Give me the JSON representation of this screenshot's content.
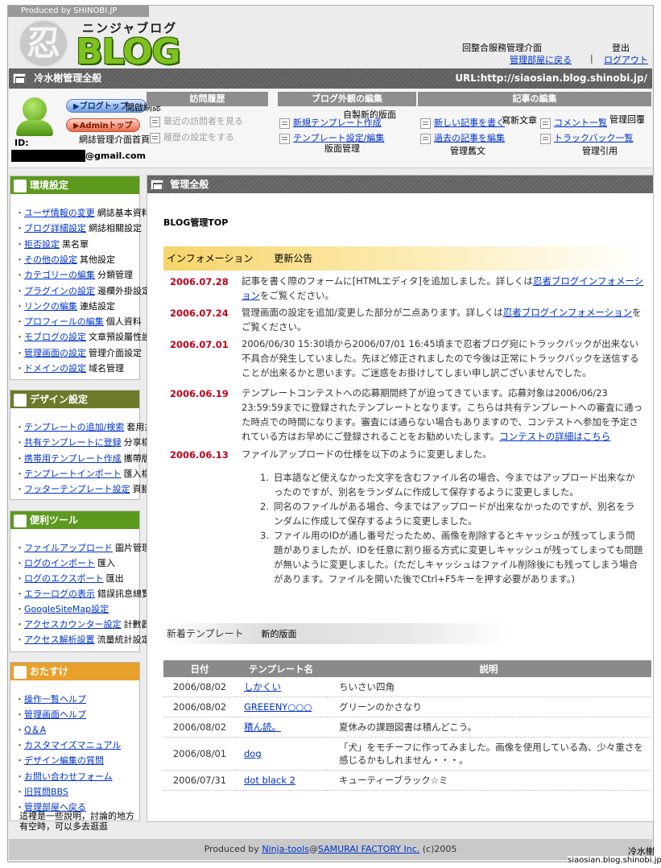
{
  "header": {
    "produced": "Produced by SHINOBI.JP",
    "logo_mark": "忍",
    "logo_sub": "ニンジャブログ",
    "logo_blog": "BLOG",
    "ann_panel": "回整合服務管理介面",
    "ann_logout": "登出",
    "admin_link": "管理部屋に戻る",
    "separator": "|",
    "logout_link": "ログアウト"
  },
  "titlebar": {
    "title": "冷水榭管理全般",
    "url": "URL:http://siaosian.blog.shinobi.jp/"
  },
  "user": {
    "blog_top_btn": "▶ブログトップ",
    "blog_top_ann": "開啟網誌",
    "admin_top_btn": "▶Adminトップ",
    "admin_top_ann": "網誌管理介面首頁",
    "id_label": "ID:",
    "email_suffix": "@gmail.com"
  },
  "columns": {
    "visit": {
      "head": "訪問履歴",
      "items": [
        "最近の訪問者を見る",
        "履歴の設定をする"
      ]
    },
    "design": {
      "head": "ブログ外観の編集",
      "items": [
        "新規テンプレート作成",
        "テンプレート設定/編集"
      ],
      "ann": [
        "自製新的版面",
        "版面管理"
      ]
    },
    "article": {
      "head": "記事の編集",
      "items": [
        "新しい記事を書く",
        "過去の記事を編集",
        "コメント一覧",
        "トラックバック一覧"
      ],
      "ann": [
        "寫新文章",
        "管理舊文",
        "管理回覆",
        "管理引用"
      ]
    }
  },
  "sidebar": {
    "env": {
      "title": "環境設定",
      "items": [
        {
          "label": "ユーザ情報の変更",
          "ann": "網誌基本資料"
        },
        {
          "label": "ブログ詳細設定",
          "ann": "網誌相關設定"
        },
        {
          "label": "拒否設定",
          "ann": "黑名單"
        },
        {
          "label": "その他の設定",
          "ann": "其他設定"
        },
        {
          "label": "カテゴリーの編集",
          "ann": "分類管理"
        },
        {
          "label": "プラグインの設定",
          "ann": "邊欄外掛設定"
        },
        {
          "label": "リンクの編集",
          "ann": "連結設定"
        },
        {
          "label": "プロフィールの編集",
          "ann": "個人資料"
        },
        {
          "label": "モブログの設定",
          "ann": "文章預設屬性設定"
        },
        {
          "label": "管理画面の設定",
          "ann": "管理介面設定"
        },
        {
          "label": "ドメインの設定",
          "ann": "域名管理"
        }
      ]
    },
    "design": {
      "title": "デザイン設定",
      "items": [
        {
          "label": "テンプレートの追加/検索",
          "ann": "套用共享樣式"
        },
        {
          "label": "共有テンプレートに登録",
          "ann": "分享樣式"
        },
        {
          "label": "携帯用テンプレート作成",
          "ann": "攜帶版樣式"
        },
        {
          "label": "テンプレートインポート",
          "ann": "匯入樣式"
        },
        {
          "label": "フッターテンプレート設定",
          "ann": "頁腳/廣告設定"
        }
      ]
    },
    "tools": {
      "title": "便利ツール",
      "items": [
        {
          "label": "ファイルアップロード",
          "ann": "圖片管理"
        },
        {
          "label": "ログのインポート",
          "ann": "匯入"
        },
        {
          "label": "ログのエクスポート",
          "ann": "匯出"
        },
        {
          "label": "エラーログの表示",
          "ann": "錯誤訊息總覽"
        },
        {
          "label": "GoogleSiteMap設定",
          "ann": ""
        },
        {
          "label": "アクセスカウンター設定",
          "ann": "計數器設定"
        },
        {
          "label": "アクセス解析設置",
          "ann": "流量統計設定"
        }
      ]
    },
    "help": {
      "title": "おたすけ",
      "items": [
        {
          "label": "操作一覧ヘルプ"
        },
        {
          "label": "管理画面ヘルプ"
        },
        {
          "label": "Q＆A"
        },
        {
          "label": "カスタマイズマニュアル"
        },
        {
          "label": "デザイン編集の質問"
        },
        {
          "label": "お問い合わせフォーム"
        },
        {
          "label": "旧質問BBS"
        },
        {
          "label": "管理部屋へ戻る"
        }
      ],
      "note_line1": "這裡是一些說明，討論的地方",
      "note_line2": "有空時，可以多去逛逛"
    }
  },
  "main": {
    "title": "管理全般",
    "page_label": "BLOG管理TOP",
    "info_title": "インフォメーション",
    "info_ann": "更新公告",
    "news": [
      {
        "date": "2006.07.28",
        "text": "記事を書く際のフォームに[HTMLエディタ]を追加しました。詳しくは",
        "link": "忍者ブログインフォメーション",
        "after": "をご覧ください。"
      },
      {
        "date": "2006.07.24",
        "text": "管理画面の設定を追加/変更した部分が二点あります。詳しくは",
        "link": "忍者ブログインフォメーション",
        "after": "をご覧ください。"
      },
      {
        "date": "2006.07.01",
        "text": "2006/06/30 15:30頃から2006/07/01 16:45頃まで忍者ブログ宛にトラックバックが出来ない不具合が発生していました。先ほど修正されましたので今後は正常にトラックバックを送信することが出来るかと思います。ご迷惑をお掛けしてしまい申し訳ございませんでした。",
        "link": "",
        "after": ""
      },
      {
        "date": "2006.06.19",
        "text": "テンプレートコンテストへの応募期間終了が迫ってきています。応募対象は2006/06/23 23:59:59までに登録されたテンプレートとなります。こちらは共有テンプレートへの審査に通った時点での時間になります。審査には通らない場合もありますので、コンテストへ参加を予定されている方はお早めにご登録されることをお勧めいたします。",
        "link": "コンテストの詳細はこちら",
        "after": ""
      },
      {
        "date": "2006.06.13",
        "text": "ファイルアップロードの仕様を以下のように変更しました。",
        "link": "",
        "after": ""
      }
    ],
    "list": [
      "日本語など使えなかった文字を含むファイル名の場合、今まではアップロード出来なかったのですが、別名をランダムに作成して保存するように変更しました。",
      "同名のファイルがある場合、今まではアップロードが出来なかったのですが、別名をランダムに作成して保存するように変更しました。",
      "ファイル用のIDが通し番号だったため、画像を削除するとキャッシュが残ってしまう問題がありましたが、IDを任意に割り振る方式に変更しキャッシュが残ってしまっても問題が無いように変更しました。(ただしキャッシュはファイル削除後にも残ってしまう場合があります。ファイルを開いた後でCtrl+F5キーを押す必要があります。)"
    ],
    "newtpl_title": "新着テンプレート",
    "newtpl_ann": "新的版面",
    "table": {
      "headers": [
        "日付",
        "テンプレート名",
        "説明"
      ],
      "rows": [
        [
          "2006/08/02",
          "しかくい",
          "ちいさい四角"
        ],
        [
          "2006/08/02",
          "GREEENY○○○",
          "グリーンのかさなり"
        ],
        [
          "2006/08/02",
          "積ん読。",
          "夏休みの課題図書は積んどこう。"
        ],
        [
          "2006/08/01",
          "dog",
          "「犬」をモチーフに作ってみました。画像を使用している為、少々重さを感じるかもしれません・・・。"
        ],
        [
          "2006/07/31",
          "dot black 2",
          "キューティーブラック☆ミ"
        ]
      ]
    }
  },
  "footer": {
    "prefix": "Produced by ",
    "link1": "Ninja-tools",
    "at": "@",
    "link2": "SAMURAI FACTORY Inc.",
    "suffix": " (c)2005",
    "sig_name": "冷水榭",
    "sig_url": "siaosian.blog.shinobi.jp"
  },
  "colors": {
    "env_head": "#5c9a1e",
    "design_head": "#6c7a2a",
    "tools_head": "#5c9a1e",
    "help_head": "#e8a02a",
    "date_red": "#c0001a"
  }
}
